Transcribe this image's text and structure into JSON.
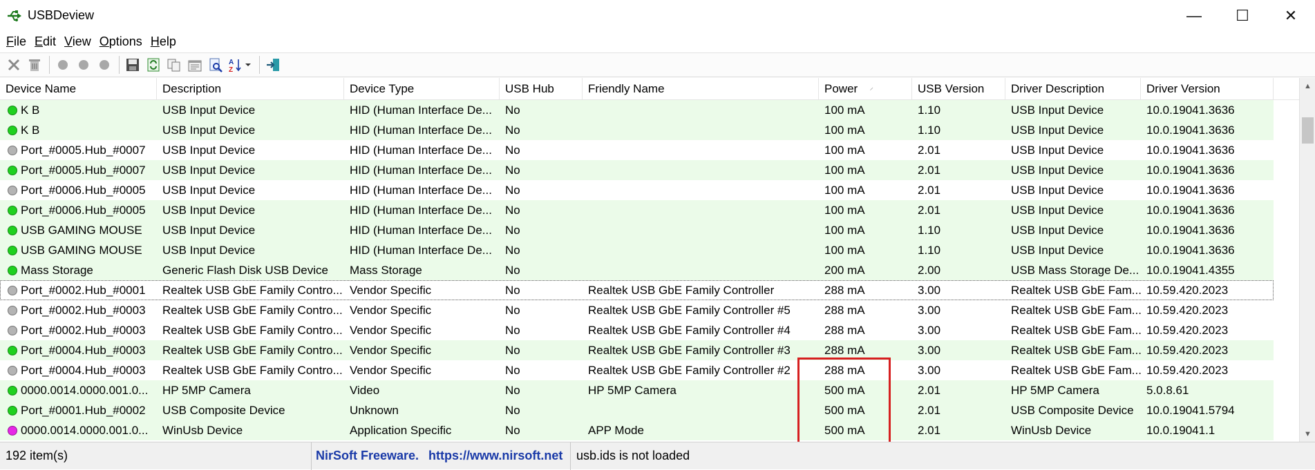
{
  "window": {
    "title": "USBDeview",
    "minimize": "—",
    "maximize": "☐",
    "close": "✕"
  },
  "menu": [
    {
      "key": "F",
      "rest": "ile"
    },
    {
      "key": "E",
      "rest": "dit"
    },
    {
      "key": "V",
      "rest": "iew"
    },
    {
      "key": "O",
      "rest": "ptions"
    },
    {
      "key": "H",
      "rest": "elp"
    }
  ],
  "toolbar_icons": [
    "disconnect-icon",
    "uninstall-icon",
    "separator",
    "enable-icon",
    "disable-icon",
    "toggle-icon",
    "separator",
    "save-icon",
    "refresh-icon",
    "copy-icon",
    "properties-icon",
    "find-icon",
    "sort-icon",
    "separator",
    "exit-icon"
  ],
  "columns": [
    "Device Name",
    "Description",
    "Device Type",
    "USB Hub",
    "Friendly Name",
    "Power",
    "USB Version",
    "Driver Description",
    "Driver Version"
  ],
  "sort_indicator": "⸝",
  "colors": {
    "connected_row": "#ebfbe9",
    "green_dot": "#1fd11f",
    "gray_dot": "#b4b4b4",
    "magenta_dot": "#e628e6",
    "highlight": "#d62020",
    "link": "#1a3aa8"
  },
  "rows": [
    {
      "status": "green",
      "bg": true,
      "cells": [
        "K B",
        "USB Input Device",
        "HID (Human Interface De...",
        "No",
        "",
        "100 mA",
        "1.10",
        "USB Input Device",
        "10.0.19041.3636"
      ]
    },
    {
      "status": "green",
      "bg": true,
      "cells": [
        "K B",
        "USB Input Device",
        "HID (Human Interface De...",
        "No",
        "",
        "100 mA",
        "1.10",
        "USB Input Device",
        "10.0.19041.3636"
      ]
    },
    {
      "status": "gray",
      "bg": false,
      "cells": [
        "Port_#0005.Hub_#0007",
        "USB Input Device",
        "HID (Human Interface De...",
        "No",
        "",
        "100 mA",
        "2.01",
        "USB Input Device",
        "10.0.19041.3636"
      ]
    },
    {
      "status": "green",
      "bg": true,
      "cells": [
        "Port_#0005.Hub_#0007",
        "USB Input Device",
        "HID (Human Interface De...",
        "No",
        "",
        "100 mA",
        "2.01",
        "USB Input Device",
        "10.0.19041.3636"
      ]
    },
    {
      "status": "gray",
      "bg": false,
      "cells": [
        "Port_#0006.Hub_#0005",
        "USB Input Device",
        "HID (Human Interface De...",
        "No",
        "",
        "100 mA",
        "2.01",
        "USB Input Device",
        "10.0.19041.3636"
      ]
    },
    {
      "status": "green",
      "bg": true,
      "cells": [
        "Port_#0006.Hub_#0005",
        "USB Input Device",
        "HID (Human Interface De...",
        "No",
        "",
        "100 mA",
        "2.01",
        "USB Input Device",
        "10.0.19041.3636"
      ]
    },
    {
      "status": "green",
      "bg": true,
      "cells": [
        "USB GAMING MOUSE",
        "USB Input Device",
        "HID (Human Interface De...",
        "No",
        "",
        "100 mA",
        "1.10",
        "USB Input Device",
        "10.0.19041.3636"
      ]
    },
    {
      "status": "green",
      "bg": true,
      "cells": [
        "USB GAMING MOUSE",
        "USB Input Device",
        "HID (Human Interface De...",
        "No",
        "",
        "100 mA",
        "1.10",
        "USB Input Device",
        "10.0.19041.3636"
      ]
    },
    {
      "status": "green",
      "bg": true,
      "cells": [
        "Mass Storage",
        "Generic Flash Disk USB Device",
        "Mass Storage",
        "No",
        "",
        "200 mA",
        "2.00",
        "USB Mass Storage De...",
        "10.0.19041.4355"
      ]
    },
    {
      "status": "gray",
      "bg": false,
      "selected": true,
      "cells": [
        "Port_#0002.Hub_#0001",
        "Realtek USB GbE Family Contro...",
        "Vendor Specific",
        "No",
        "Realtek USB GbE Family Controller",
        "288 mA",
        "3.00",
        "Realtek USB GbE Fam...",
        "10.59.420.2023"
      ]
    },
    {
      "status": "gray",
      "bg": false,
      "cells": [
        "Port_#0002.Hub_#0003",
        "Realtek USB GbE Family Contro...",
        "Vendor Specific",
        "No",
        "Realtek USB GbE Family Controller #5",
        "288 mA",
        "3.00",
        "Realtek USB GbE Fam...",
        "10.59.420.2023"
      ]
    },
    {
      "status": "gray",
      "bg": false,
      "cells": [
        "Port_#0002.Hub_#0003",
        "Realtek USB GbE Family Contro...",
        "Vendor Specific",
        "No",
        "Realtek USB GbE Family Controller #4",
        "288 mA",
        "3.00",
        "Realtek USB GbE Fam...",
        "10.59.420.2023"
      ]
    },
    {
      "status": "green",
      "bg": true,
      "cells": [
        "Port_#0004.Hub_#0003",
        "Realtek USB GbE Family Contro...",
        "Vendor Specific",
        "No",
        "Realtek USB GbE Family Controller #3",
        "288 mA",
        "3.00",
        "Realtek USB GbE Fam...",
        "10.59.420.2023"
      ]
    },
    {
      "status": "gray",
      "bg": false,
      "cells": [
        "Port_#0004.Hub_#0003",
        "Realtek USB GbE Family Contro...",
        "Vendor Specific",
        "No",
        "Realtek USB GbE Family Controller #2",
        "288 mA",
        "3.00",
        "Realtek USB GbE Fam...",
        "10.59.420.2023"
      ]
    },
    {
      "status": "green",
      "bg": true,
      "cells": [
        "0000.0014.0000.001.0...",
        "HP 5MP Camera",
        "Video",
        "No",
        "HP 5MP Camera",
        "500 mA",
        "2.01",
        "HP 5MP Camera",
        "5.0.8.61"
      ]
    },
    {
      "status": "green",
      "bg": true,
      "cells": [
        "Port_#0001.Hub_#0002",
        "USB Composite Device",
        "Unknown",
        "No",
        "",
        "500 mA",
        "2.01",
        "USB Composite Device",
        "10.0.19041.5794"
      ]
    },
    {
      "status": "magenta",
      "bg": true,
      "cells": [
        "0000.0014.0000.001.0...",
        "WinUsb Device",
        "Application Specific",
        "No",
        "APP Mode",
        "500 mA",
        "2.01",
        "WinUsb Device",
        "10.0.19041.1"
      ]
    }
  ],
  "status": {
    "count": "192 item(s)",
    "nirsoft": "NirSoft Freeware.",
    "url": "https://www.nirsoft.net",
    "usbids": "usb.ids is not loaded"
  }
}
